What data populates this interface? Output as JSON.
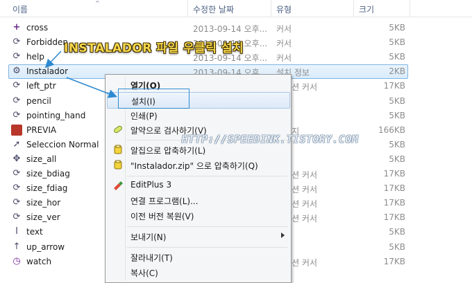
{
  "header": {
    "name_col": "이름",
    "date_col": "수정한 날짜",
    "type_col": "유형",
    "size_col": "크기"
  },
  "files": [
    {
      "name": "cross",
      "date": "2013-09-14 오후...",
      "type": "커서",
      "size": "5KB",
      "icon": "plus-cursor-icon"
    },
    {
      "name": "Forbidden",
      "date": "2013-09-14 오후...",
      "type": "커서",
      "size": "5KB",
      "icon": "busy-cursor-icon"
    },
    {
      "name": "help",
      "date": "2013-09-14 오후...",
      "type": "커서",
      "size": "5KB",
      "icon": "busy-cursor-icon"
    },
    {
      "name": "Instalador",
      "date": "2013-09-14 오후...",
      "type": "설치 정보",
      "size": "2KB",
      "icon": "setup-info-icon"
    },
    {
      "name": "left_ptr",
      "date": "",
      "type": "메이션 커서",
      "size": "17KB",
      "icon": "busy-cursor-icon"
    },
    {
      "name": "pencil",
      "date": "",
      "type": "",
      "size": "5KB",
      "icon": "busy-cursor-icon"
    },
    {
      "name": "pointing_hand",
      "date": "",
      "type": "",
      "size": "5KB",
      "icon": "busy-cursor-icon"
    },
    {
      "name": "PREVIA",
      "date": "",
      "type": "이미지",
      "size": "166KB",
      "icon": "image-file-icon"
    },
    {
      "name": "Seleccion Normal",
      "date": "",
      "type": "",
      "size": "5KB",
      "icon": "arrow-cursor-icon"
    },
    {
      "name": "size_all",
      "date": "",
      "type": "",
      "size": "5KB",
      "icon": "move-cursor-icon"
    },
    {
      "name": "size_bdiag",
      "date": "",
      "type": "메이션 커서",
      "size": "17KB",
      "icon": "busy-cursor-icon"
    },
    {
      "name": "size_fdiag",
      "date": "",
      "type": "메이션 커서",
      "size": "17KB",
      "icon": "busy-cursor-icon"
    },
    {
      "name": "size_hor",
      "date": "",
      "type": "메이션 커서",
      "size": "17KB",
      "icon": "busy-cursor-icon"
    },
    {
      "name": "size_ver",
      "date": "",
      "type": "메이션 커서",
      "size": "17KB",
      "icon": "busy-cursor-icon"
    },
    {
      "name": "text",
      "date": "",
      "type": "",
      "size": "5KB",
      "icon": "text-cursor-icon"
    },
    {
      "name": "up_arrow",
      "date": "",
      "type": "",
      "size": "5KB",
      "icon": "up-arrow-cursor-icon"
    },
    {
      "name": "watch",
      "date": "",
      "type": "메이션 커서",
      "size": "17KB",
      "icon": "watch-cursor-icon"
    }
  ],
  "context_menu": {
    "open": "열기(O)",
    "install": "설치(I)",
    "print": "인쇄(P)",
    "scan": "알약으로 검사하기(V)",
    "compress": "알집으로 압축하기(L)",
    "compress_zip": "\"Instalador.zip\" 으로 압축하기(Q)",
    "editplus": "EditPlus 3",
    "open_with": "연결 프로그램(L)...",
    "restore": "이전 버전 복원(V)",
    "send_to": "보내기(N)",
    "cut": "잘라내기(T)",
    "copy": "복사(C)"
  },
  "annotation": {
    "callout": "INSTALADOR 파일 우클릭 설치",
    "watermark": "HTTP://SPEEDINK.TISTORY.COM"
  },
  "colors": {
    "accent_blue": "#2e8ad0",
    "callout_yellow": "#f7d84a",
    "header_text": "#4d6185"
  }
}
